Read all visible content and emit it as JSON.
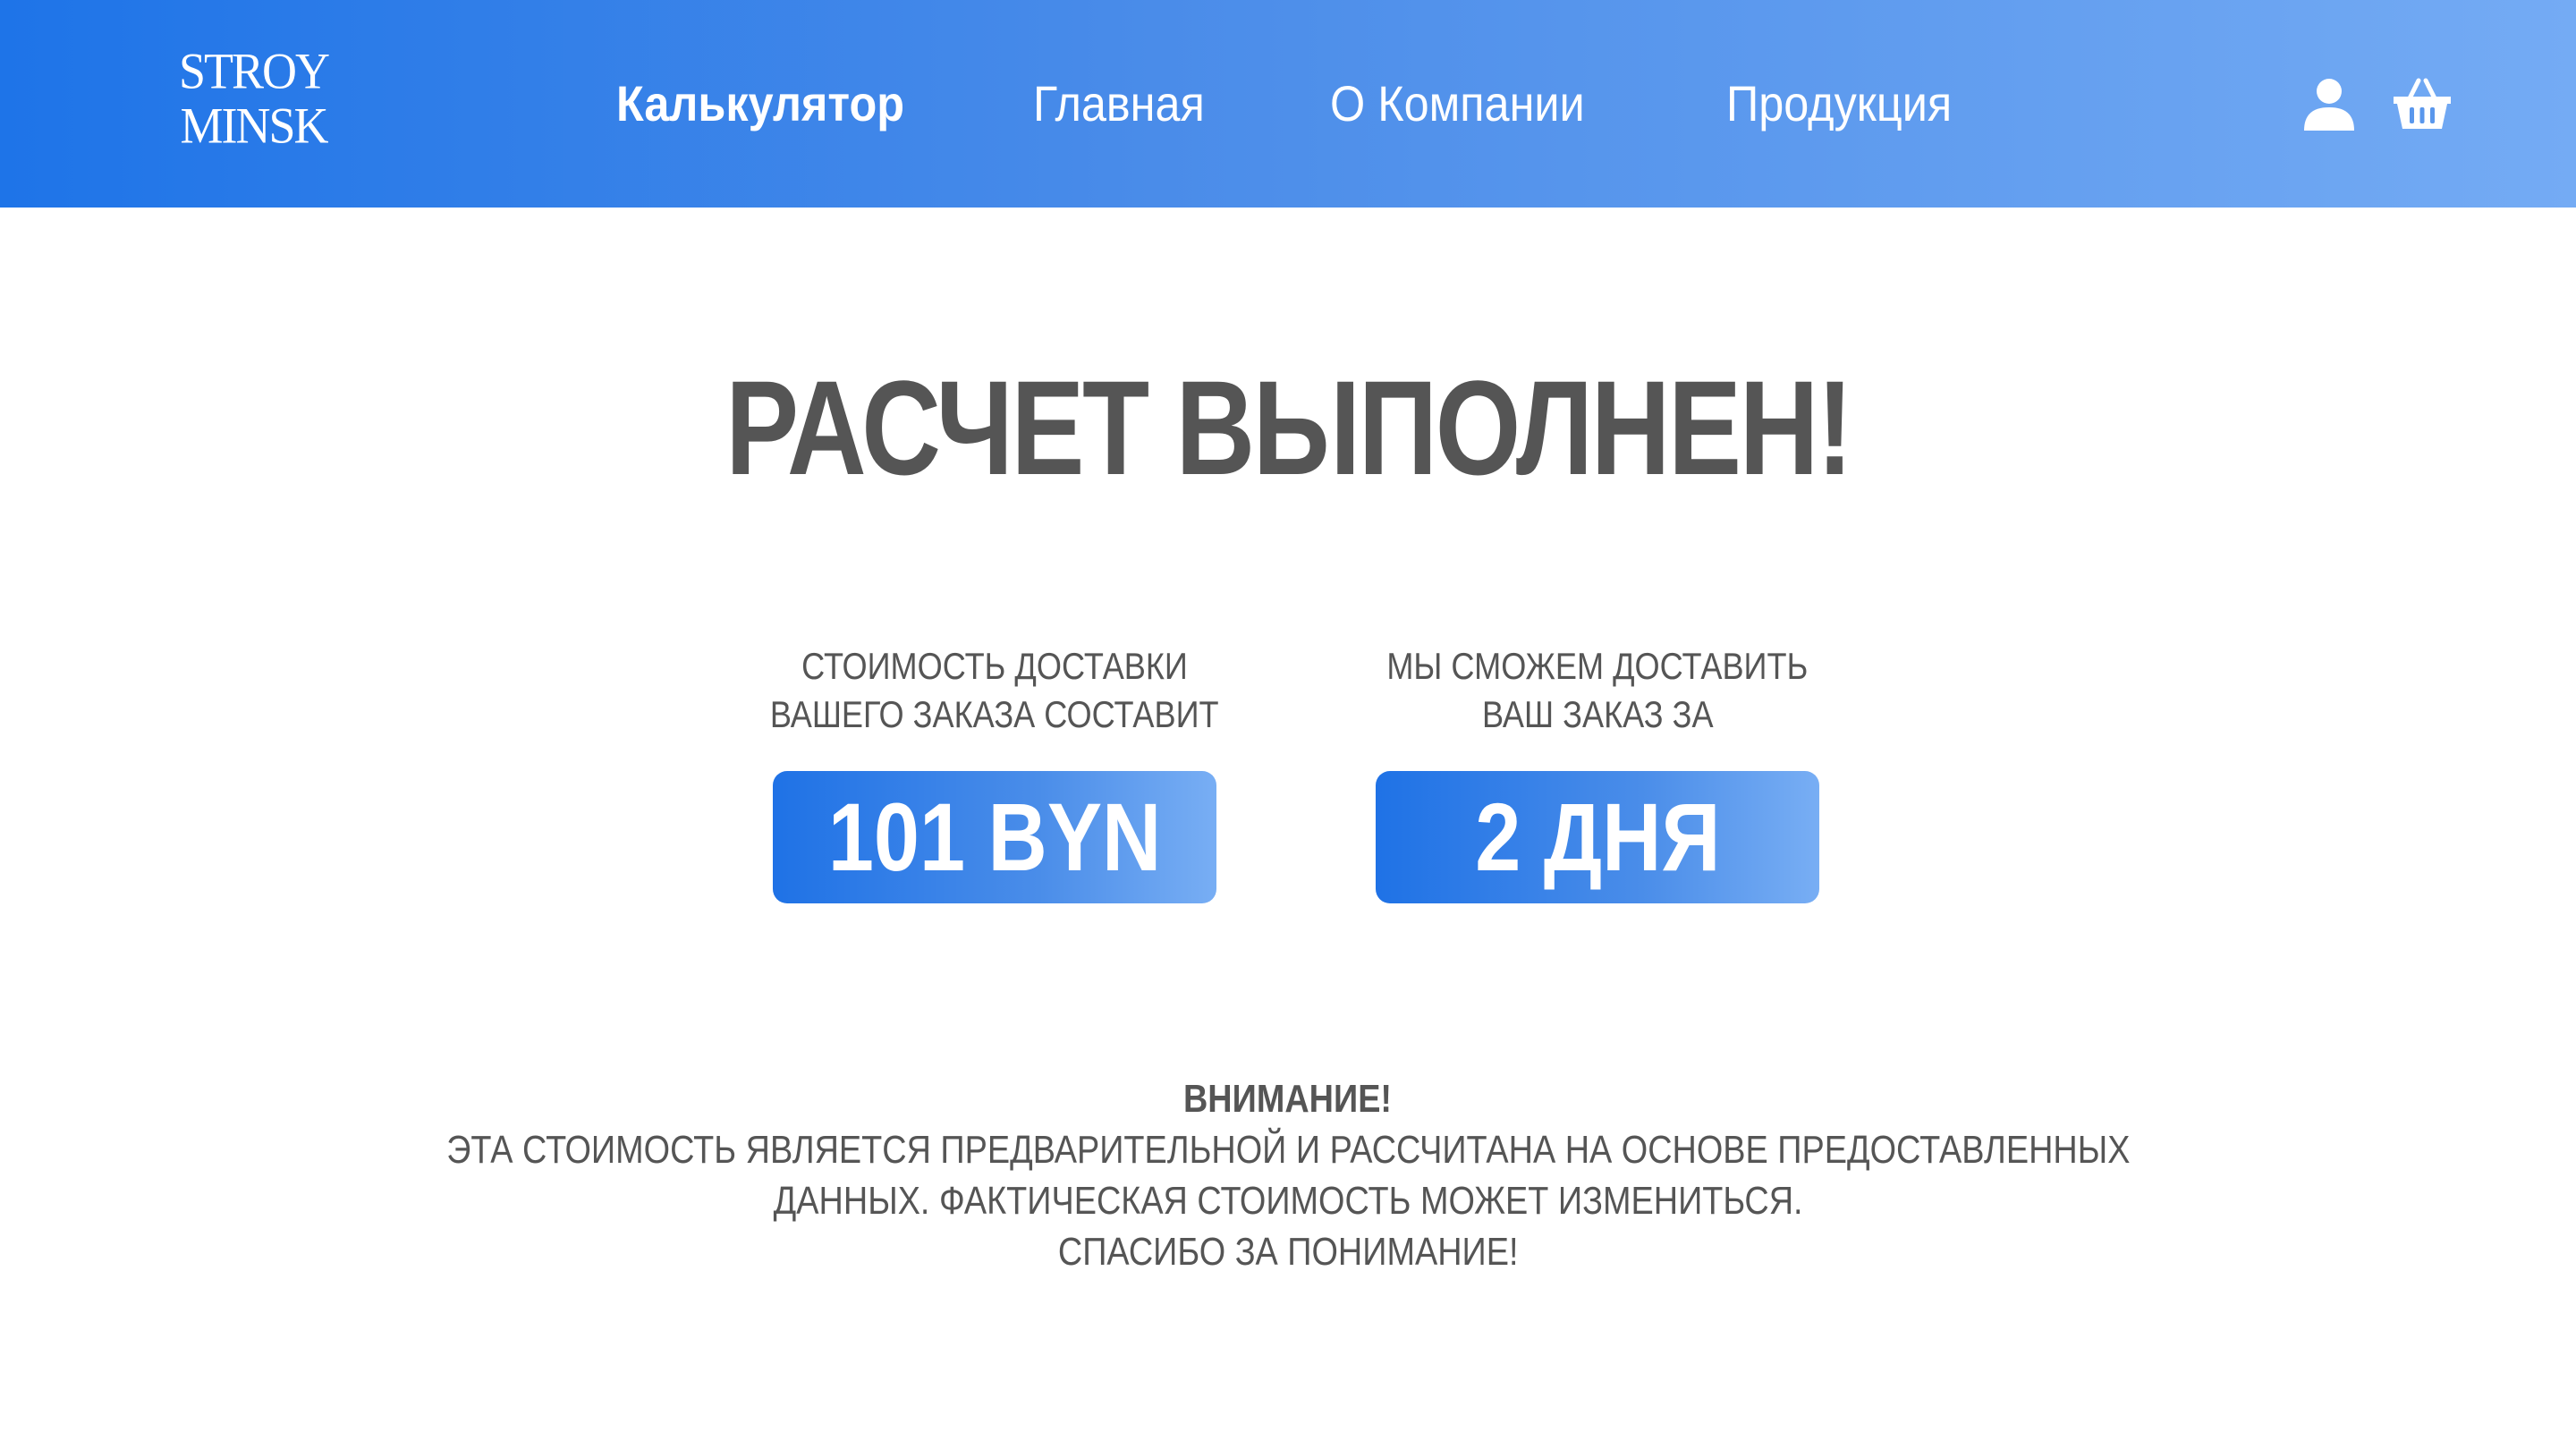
{
  "header": {
    "logo_line1": "STROY",
    "logo_line2": "MINSK",
    "nav": [
      {
        "label": "Калькулятор",
        "active": true
      },
      {
        "label": "Главная",
        "active": false
      },
      {
        "label": "О Компании",
        "active": false
      },
      {
        "label": "Продукция",
        "active": false
      }
    ],
    "icons": [
      "user-icon",
      "cart-icon"
    ],
    "gradient_start": "#1e74e8",
    "gradient_end": "#74abf4"
  },
  "main": {
    "title": "РАСЧЕТ ВЫПОЛНЕН!",
    "cost": {
      "label_line1": "СТОИМОСТЬ ДОСТАВКИ",
      "label_line2": "ВАШЕГО ЗАКАЗА СОСТАВИТ",
      "value": "101 BYN"
    },
    "delivery": {
      "label_line1": "МЫ СМОЖЕМ ДОСТАВИТЬ",
      "label_line2": "ВАШ ЗАКАЗ ЗА",
      "value": "2 ДНЯ"
    },
    "notice": {
      "heading": "ВНИМАНИЕ!",
      "line1": "ЭТА СТОИМОСТЬ ЯВЛЯЕТСЯ ПРЕДВАРИТЕЛЬНОЙ И РАССЧИТАНА НА ОСНОВЕ ПРЕДОСТАВЛЕННЫХ",
      "line2": "ДАННЫХ. ФАКТИЧЕСКАЯ СТОИМОСТЬ МОЖЕТ ИЗМЕНИТЬСЯ.",
      "line3": "СПАСИБО ЗА ПОНИМАНИЕ!"
    }
  },
  "colors": {
    "text_gray": "#555555",
    "accent_blue": "#1f72e6"
  }
}
